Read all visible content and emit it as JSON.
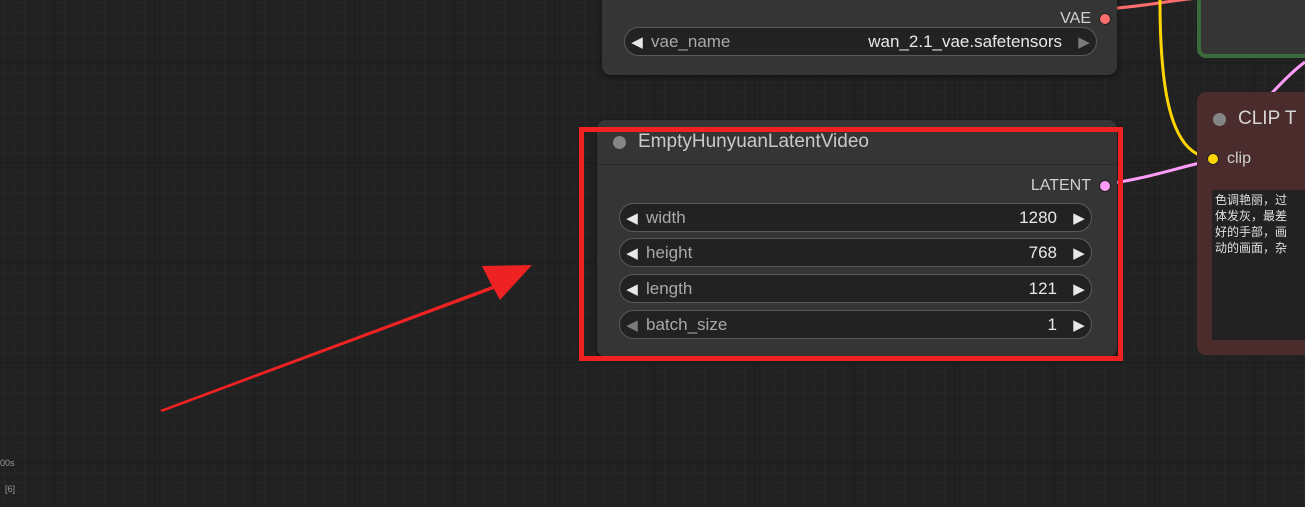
{
  "vae_node": {
    "output_label": "VAE",
    "widget_label": "vae_name",
    "widget_value": "wan_2.1_vae.safetensors"
  },
  "latent_node": {
    "title": "EmptyHunyuanLatentVideo",
    "output_label": "LATENT",
    "widgets": [
      {
        "label": "width",
        "value": "1280"
      },
      {
        "label": "height",
        "value": "768"
      },
      {
        "label": "length",
        "value": "121"
      },
      {
        "label": "batch_size",
        "value": "1"
      }
    ]
  },
  "clip_node": {
    "title": "CLIP T",
    "input_label": "clip",
    "text": "色调艳丽，过\n体发灰，最差\n好的手部，画\n动的画面，杂"
  },
  "corner_stats": {
    "line1": "00s",
    "line2": "[6]"
  },
  "colors": {
    "highlight_border": "#ee2222",
    "arrow": "#ee2222",
    "vae_link": "#ff6e6e",
    "clip_link": "#ffd500",
    "latent_link": "#ff9cf9",
    "green_node_border": "#3b6b3b",
    "clip_node_bg": "#4a2c2c"
  }
}
